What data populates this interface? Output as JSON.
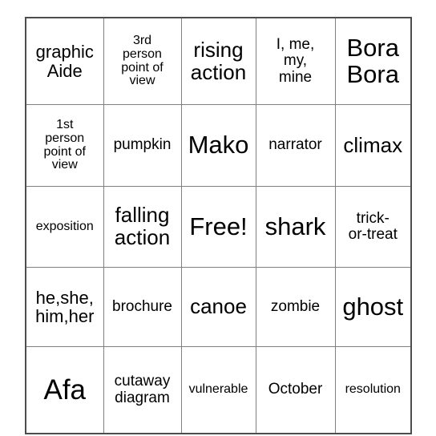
{
  "card": {
    "type": "bingo-card",
    "columns": 5,
    "rows": 5,
    "free_space": "Free!",
    "colors": {
      "background": "#ffffff",
      "grid_line": "#808080",
      "outer_border": "#4d4d4d",
      "text": "#000000"
    },
    "cells": [
      [
        {
          "text": "graphic\nAide",
          "size": "lg",
          "valign": "mid",
          "halign": "center"
        },
        {
          "text": "3rd\nperson\npoint of\nview",
          "size": "sm",
          "valign": "mid",
          "halign": "center"
        },
        {
          "text": "rising\naction",
          "size": "xl",
          "valign": "mid",
          "halign": "center"
        },
        {
          "text": "I, me,\nmy,\nmine",
          "size": "md",
          "valign": "mid",
          "halign": "center"
        },
        {
          "text": "Bora\nBora",
          "size": "xxl",
          "valign": "mid",
          "halign": "center"
        }
      ],
      [
        {
          "text": "1st\nperson\npoint of\nview",
          "size": "sm",
          "valign": "mid",
          "halign": "right"
        },
        {
          "text": "pumpkin",
          "size": "md",
          "valign": "mid",
          "halign": "center"
        },
        {
          "text": "Mako",
          "size": "xxl",
          "valign": "mid",
          "halign": "center"
        },
        {
          "text": "narrator",
          "size": "md",
          "valign": "mid",
          "halign": "center"
        },
        {
          "text": "climax",
          "size": "xl",
          "valign": "mid",
          "halign": "center"
        }
      ],
      [
        {
          "text": "exposition",
          "size": "sm",
          "valign": "mid",
          "halign": "center"
        },
        {
          "text": "falling\naction",
          "size": "xl",
          "valign": "mid",
          "halign": "center"
        },
        {
          "text": "Free!",
          "size": "xxl",
          "valign": "mid",
          "halign": "center"
        },
        {
          "text": "shark",
          "size": "xxl",
          "valign": "mid",
          "halign": "center"
        },
        {
          "text": "trick-\nor-treat",
          "size": "md",
          "valign": "mid",
          "halign": "center"
        }
      ],
      [
        {
          "text": "he,she,\nhim,her",
          "size": "lg",
          "valign": "top",
          "halign": "center"
        },
        {
          "text": "brochure",
          "size": "md",
          "valign": "mid",
          "halign": "center"
        },
        {
          "text": "canoe",
          "size": "xl",
          "valign": "mid",
          "halign": "center"
        },
        {
          "text": "zombie",
          "size": "md",
          "valign": "mid",
          "halign": "center"
        },
        {
          "text": "ghost",
          "size": "xxl",
          "valign": "mid",
          "halign": "center"
        }
      ],
      [
        {
          "text": "Afa",
          "size": "xxxl",
          "valign": "bottom",
          "halign": "center"
        },
        {
          "text": "cutaway\ndiagram",
          "size": "md",
          "valign": "bottom",
          "halign": "center"
        },
        {
          "text": "vulnerable",
          "size": "sm",
          "valign": "bottom",
          "halign": "center"
        },
        {
          "text": "October",
          "size": "md",
          "valign": "bottom",
          "halign": "center"
        },
        {
          "text": "resolution",
          "size": "sm",
          "valign": "bottom",
          "halign": "center"
        }
      ]
    ]
  }
}
